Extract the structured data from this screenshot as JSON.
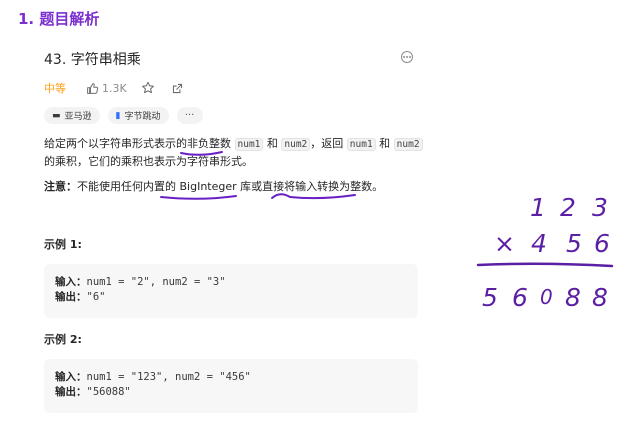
{
  "section": {
    "title": "1. 题目解析"
  },
  "problem": {
    "title": "43. 字符串相乘",
    "difficulty": "中等",
    "likes": "1.3K"
  },
  "tags": [
    "亚马逊",
    "字节跳动",
    "···"
  ],
  "description": {
    "part1": "给定两个以字符串形式表示的",
    "highlight1": "非负整数",
    "code1": "num1",
    "and1": " 和 ",
    "code2": "num2",
    "part2": "，返回 ",
    "code3": "num1",
    "and2": " 和 ",
    "code4": "num2",
    "part3": " 的乘积，它们的乘积也表示为字符串形式。"
  },
  "note": {
    "label": "注意：",
    "part1": "不能使用任何内置的 BigInteger 库或直接将",
    "highlight": "输入转换为整数",
    "end": "。"
  },
  "examples": [
    {
      "title": "示例 1:",
      "input_label": "输入：",
      "input": "num1 = \"2\", num2 = \"3\"",
      "output_label": "输出：",
      "output": "\"6\""
    },
    {
      "title": "示例 2:",
      "input_label": "输入：",
      "input": "num1 = \"123\", num2 = \"456\"",
      "output_label": "输出：",
      "output": "\"56088\""
    }
  ],
  "handwriting": {
    "row1": [
      "1",
      "2",
      "3"
    ],
    "row2": [
      "×",
      "4",
      "5",
      "6"
    ],
    "row3": [
      "5",
      "6",
      "0",
      "8",
      "8"
    ],
    "ink_color": "#5b1fa3"
  },
  "colors": {
    "section_title": "#7b2fd0",
    "difficulty": "#ffa116",
    "underline": "#6a1fc4"
  }
}
